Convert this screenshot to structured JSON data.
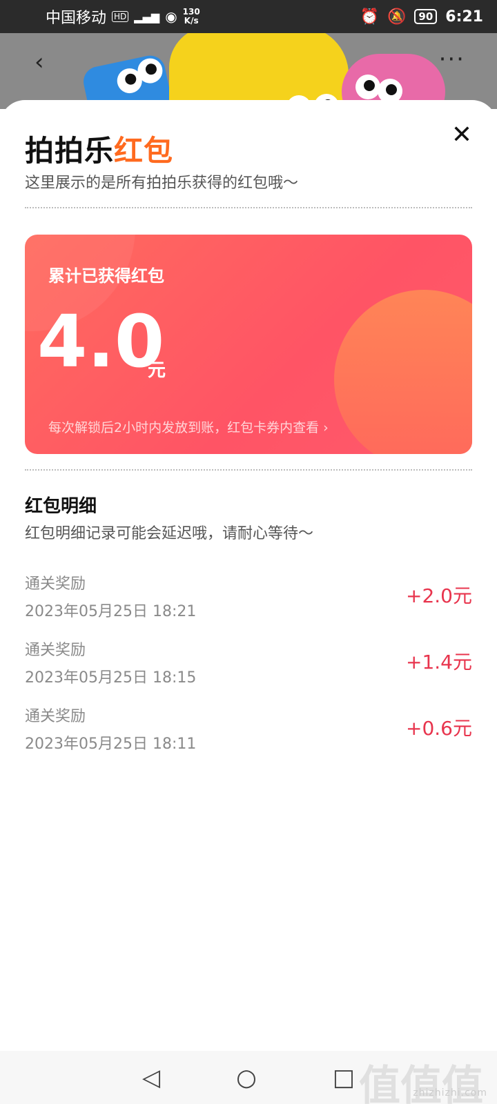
{
  "status_bar": {
    "carrier": "中国移动",
    "hd": "HD",
    "net_speed": "130",
    "net_unit": "K/s",
    "battery": "90",
    "time": "6:21"
  },
  "background": {
    "back_icon": "chevron-left-icon",
    "more_icon": "more-icon"
  },
  "sheet": {
    "title_prefix": "拍拍乐",
    "title_accent": "红包",
    "subtitle": "这里展示的是所有拍拍乐获得的红包哦～",
    "close_icon": "close-icon"
  },
  "card": {
    "label": "累计已获得红包",
    "amount": "4.0",
    "unit": "元",
    "note": "每次解锁后2小时内发放到账，红包卡券内查看 ›"
  },
  "details": {
    "title": "红包明细",
    "subtitle": "红包明细记录可能会延迟哦，请耐心等待～",
    "records": [
      {
        "title": "通关奖励",
        "time": "2023年05月25日 18:21",
        "amount": "+2.0元"
      },
      {
        "title": "通关奖励",
        "time": "2023年05月25日 18:15",
        "amount": "+1.4元"
      },
      {
        "title": "通关奖励",
        "time": "2023年05月25日 18:11",
        "amount": "+0.6元"
      }
    ]
  },
  "navbar": {
    "back": "◁",
    "home": "○",
    "recent": "□"
  },
  "watermark": "zhizhizhi.com",
  "watermark_logo": "值值值",
  "colors": {
    "accent_orange": "#ff6a1f",
    "card_red": "#ff5465",
    "amount_red": "#e8344d"
  }
}
